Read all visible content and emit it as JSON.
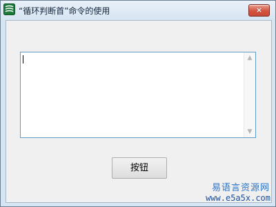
{
  "window": {
    "title": "“循环判断首”命令的使用",
    "close_icon": "close-icon"
  },
  "main": {
    "text_area": {
      "value": "",
      "scrollbar_up_icon": "chevron-up-icon",
      "scrollbar_down_icon": "chevron-down-icon"
    },
    "button": {
      "label": "按钮"
    }
  },
  "watermark": {
    "chinese": "易语言资源网",
    "url": "www.e5a5x.com"
  },
  "colors": {
    "title_bar_top": "#e9f1f9",
    "close_button": "#d4533f",
    "edit_border": "#5e9cc7",
    "watermark": "#2b73c8"
  }
}
